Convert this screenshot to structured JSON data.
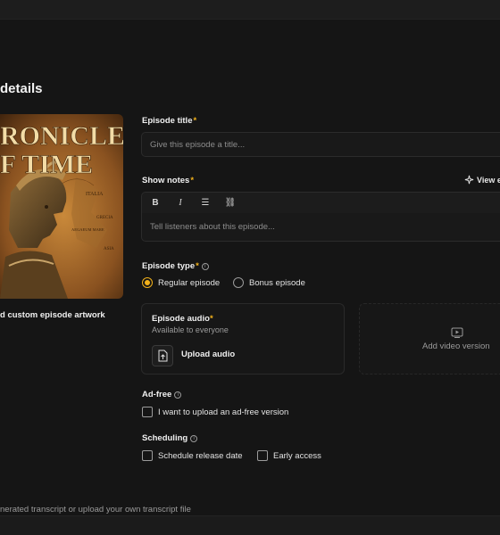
{
  "section": {
    "title": "details"
  },
  "artwork": {
    "title_line1": "RONICLES",
    "title_line2": "F TIME",
    "map_labels": [
      "ITALIA",
      "GRECIA",
      "AEGAEUM MARE",
      "ASIA"
    ],
    "caption": "d custom episode artwork"
  },
  "episode_title": {
    "label": "Episode title",
    "required": "*",
    "placeholder": "Give this episode a title..."
  },
  "show_notes": {
    "label": "Show notes",
    "required": "*",
    "view_example": "View e",
    "placeholder": "Tell listeners about this episode...",
    "toolbar": [
      {
        "icon": "bold-icon",
        "glyph": "B"
      },
      {
        "icon": "italic-icon",
        "glyph": "I"
      },
      {
        "icon": "list-icon",
        "glyph": "☰"
      },
      {
        "icon": "link-icon",
        "glyph": "⛓"
      }
    ]
  },
  "episode_type": {
    "label": "Episode type",
    "required": "*",
    "options": [
      "Regular episode",
      "Bonus episode"
    ],
    "selected": "Regular episode"
  },
  "episode_audio": {
    "title": "Episode audio",
    "required": "*",
    "subtitle": "Available to everyone",
    "upload_label": "Upload audio"
  },
  "video": {
    "label": "Add video version"
  },
  "ad_free": {
    "label": "Ad-free",
    "checkbox_label": "I want to upload an ad-free version"
  },
  "scheduling": {
    "label": "Scheduling",
    "options": [
      "Schedule release date",
      "Early access"
    ]
  },
  "transcript": {
    "text": "nerated transcript or upload your own transcript file"
  },
  "colors": {
    "accent": "#f3b21b",
    "background": "#151515",
    "border": "#2b2b2b"
  }
}
